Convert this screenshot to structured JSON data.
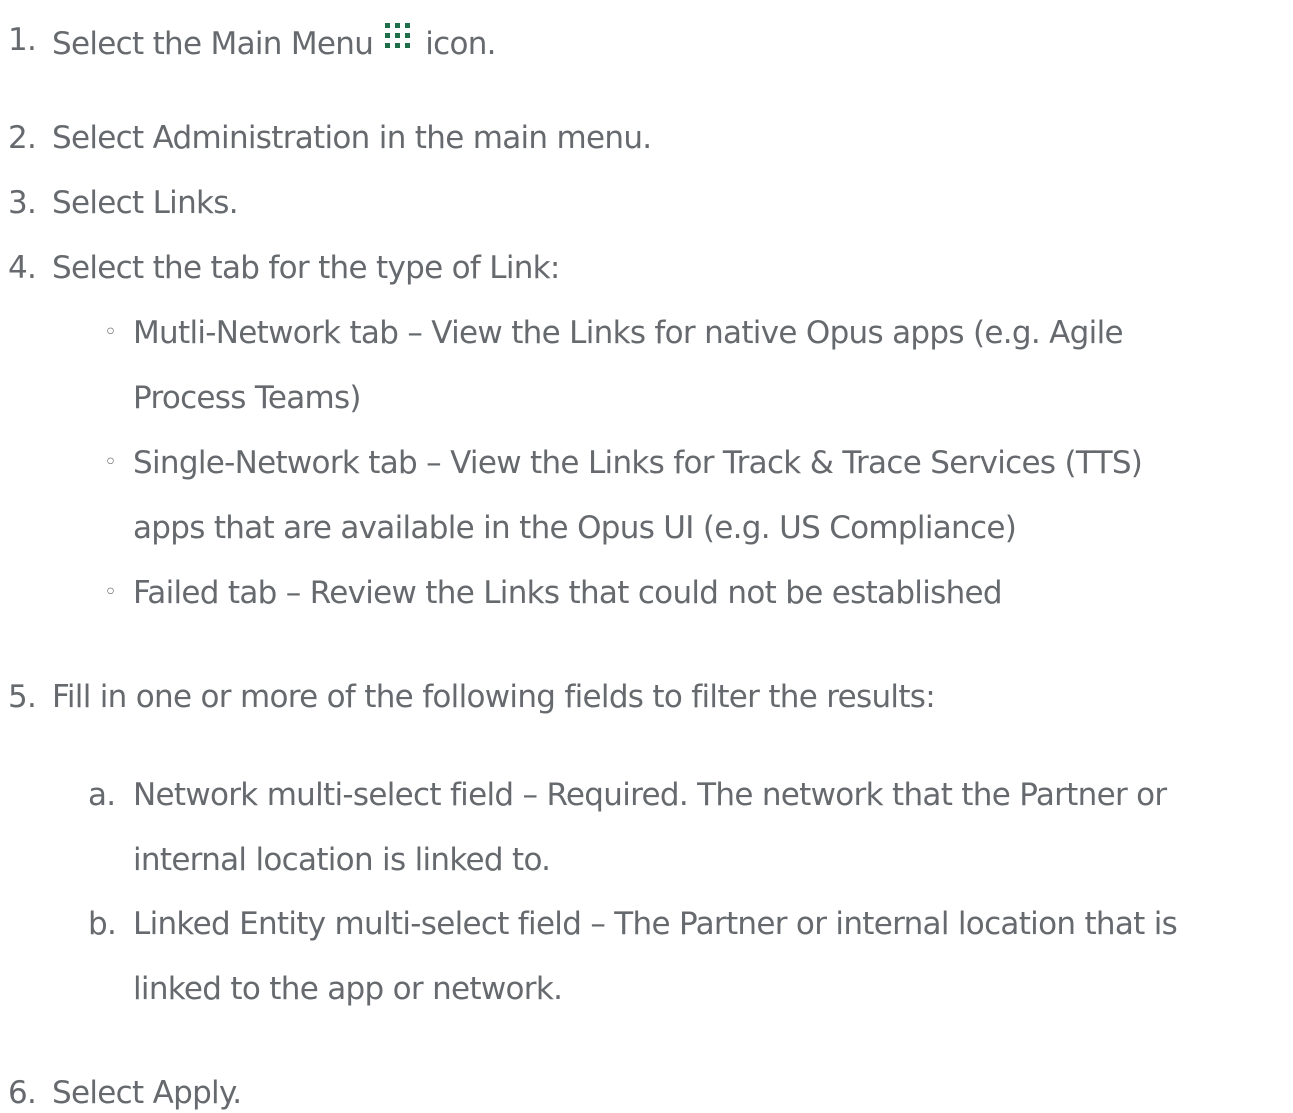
{
  "steps": [
    {
      "num": "1.",
      "before_icon": "Select the Main Menu",
      "icon": "grid-dots-icon",
      "after_icon": "icon."
    },
    {
      "num": "2.",
      "text": "Select Administration in the main menu."
    },
    {
      "num": "3.",
      "text": "Select Links."
    },
    {
      "num": "4.",
      "text": "Select the tab for the type of Link:",
      "bullets": [
        {
          "marker": "◦",
          "line1": "Mutli-Network tab – View the Links for native Opus apps (e.g. Agile",
          "line2": "Process Teams)"
        },
        {
          "marker": "◦",
          "line1": "Single-Network tab – View the Links for Track & Trace Services (TTS)",
          "line2": "apps that are available in the Opus UI (e.g. US Compliance)"
        },
        {
          "marker": "◦",
          "line1": "Failed tab – Review the Links that could not be established"
        }
      ]
    },
    {
      "num": "5.",
      "text": "Fill in one or more of the following fields to filter the results:",
      "items": [
        {
          "marker": "a.",
          "line1": "Network multi-select field – Required. The network that the Partner or",
          "line2": "internal location is linked to."
        },
        {
          "marker": "b.",
          "line1": "Linked Entity multi-select field – The Partner or internal location that is",
          "line2": "linked to the app or network."
        }
      ]
    },
    {
      "num": "6.",
      "text": "Select Apply."
    }
  ],
  "colors": {
    "text": "#666a6e",
    "icon": "#1e6e4a"
  }
}
